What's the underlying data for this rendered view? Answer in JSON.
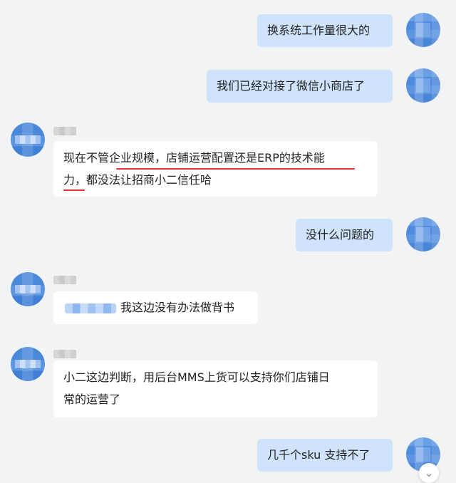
{
  "messages": [
    {
      "side": "me",
      "text": "换系统工作量很大的"
    },
    {
      "side": "me",
      "text": "我们已经对接了微信小商店了"
    },
    {
      "side": "other",
      "line1": "现在不管企业规模，店铺运营配置还是ERP的技术能",
      "line2": "力，都没法让招商小二信任哈"
    },
    {
      "side": "me",
      "text": "没什么问题的"
    },
    {
      "side": "other",
      "text": "我这边没有办法做背书"
    },
    {
      "side": "other",
      "line1": "小二这边判断，用后台MMS上货可以支持你们店铺日",
      "line2": "常的运营了"
    },
    {
      "side": "me",
      "text": "几千个sku 支持不了"
    }
  ],
  "scroll_button_icon": "chevron-double-down-icon",
  "scroll_button_glyph": "⌄",
  "colors": {
    "my_bubble": "#cfe3fb",
    "other_bubble": "#ffffff",
    "background": "#f2f3f5",
    "highlight_underline": "#e0302d"
  }
}
